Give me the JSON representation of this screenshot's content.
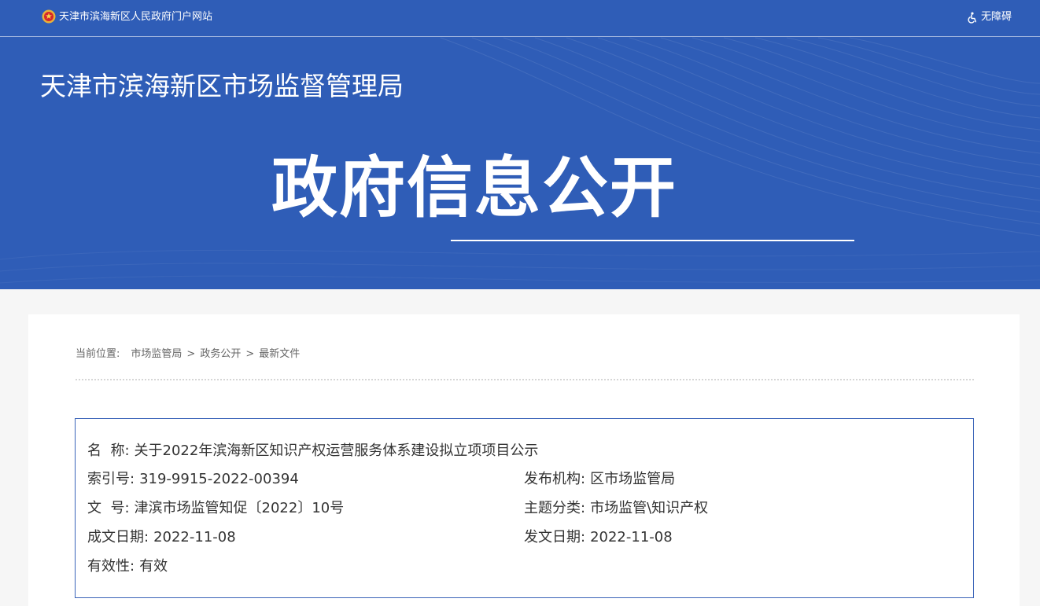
{
  "header": {
    "portal_link": "天津市滨海新区人民政府门户网站",
    "accessibility_label": "无障碍",
    "bureau_name": "天津市滨海新区市场监督管理局",
    "section_title": "政府信息公开"
  },
  "breadcrumb": {
    "label": "当前位置:",
    "items": [
      "市场监管局",
      "政务公开",
      "最新文件"
    ],
    "separator": ">"
  },
  "document": {
    "name_label": "名  称:",
    "name_value": "关于2022年滨海新区知识产权运营服务体系建设拟立项项目公示",
    "index_label": "索引号:",
    "index_value": "319-9915-2022-00394",
    "publisher_label": "发布机构:",
    "publisher_value": "区市场监管局",
    "docno_label": "文  号:",
    "docno_value": "津滨市场监管知促〔2022〕10号",
    "topic_label": "主题分类:",
    "topic_value": "市场监管\\知识产权",
    "created_label": "成文日期:",
    "created_value": "2022-11-08",
    "issued_label": "发文日期:",
    "issued_value": "2022-11-08",
    "validity_label": "有效性:",
    "validity_value": "有效"
  },
  "colors": {
    "banner": "#2f5db7",
    "box_border": "#3a63b8"
  },
  "icons": [
    "national-emblem-icon",
    "accessibility-icon"
  ]
}
